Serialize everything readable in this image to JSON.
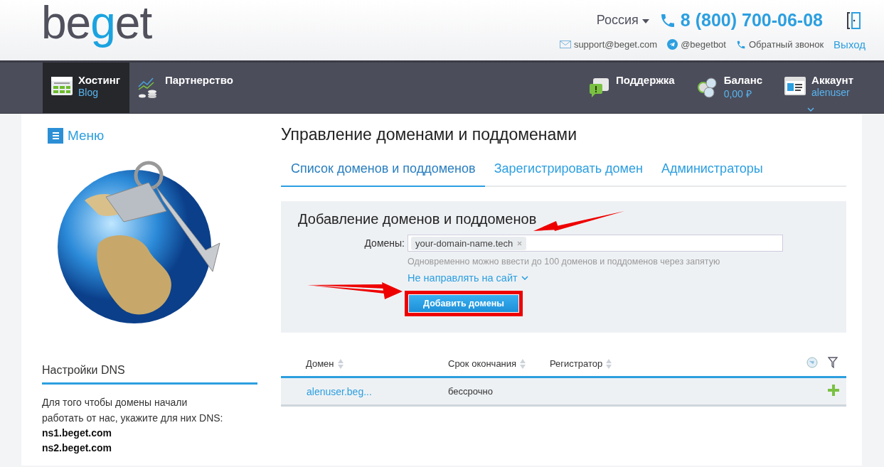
{
  "header": {
    "logo": "beget",
    "region": "Россия",
    "phone": "8 (800) 700-06-08",
    "contacts": [
      {
        "kind": "mail",
        "label": "support@beget.com"
      },
      {
        "kind": "telegram",
        "label": "@begetbot"
      },
      {
        "kind": "phone",
        "label": "Обратный звонок"
      }
    ],
    "logout": "Выход"
  },
  "nav": {
    "left": [
      {
        "kind": "hosting",
        "label": "Хостинг",
        "sub": "Blog",
        "selected": true
      },
      {
        "kind": "partner",
        "label": "Партнерство",
        "selected": false
      }
    ],
    "right": [
      {
        "kind": "support",
        "label": "Поддержка",
        "selected": false
      },
      {
        "kind": "balance",
        "label": "Баланс",
        "sub": "0,00 ₽",
        "selected": false
      },
      {
        "kind": "account",
        "label": "Аккаунт",
        "sub": "alenuser",
        "selected": false
      }
    ]
  },
  "sidebar": {
    "menu": "Меню",
    "dns_title": "Настройки DNS",
    "dns_text": "Для того чтобы домены начали работать от нас, укажите для них DNS:",
    "nameservers": [
      "ns1.beget.com",
      "ns2.beget.com"
    ]
  },
  "page": {
    "title": "Управление доменами и поддоменами",
    "tabs": [
      {
        "label": "Список доменов и поддоменов",
        "selected": true
      },
      {
        "label": "Зарегистрировать домен",
        "selected": false
      },
      {
        "label": "Администраторы",
        "selected": false
      }
    ],
    "form": {
      "title": "Добавление доменов и поддоменов",
      "field_label": "Домены:",
      "tags": [
        "your-domain-name.tech"
      ],
      "hint": "Одновременно можно ввести до 100 доменов и поддоменов через запятую",
      "option": "Не направлять на сайт",
      "button": "Добавить домены"
    },
    "table": {
      "columns": [
        "Домен",
        "Срок окончания",
        "Регистратор"
      ],
      "rows": [
        {
          "domain": "alenuser.beg...",
          "expires": "бессрочно",
          "registrar": ""
        }
      ]
    }
  }
}
